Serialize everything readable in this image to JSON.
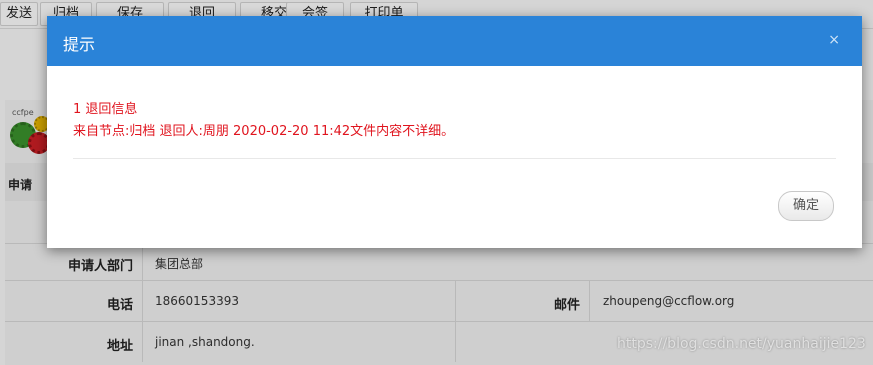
{
  "toolbar": {
    "buttons": [
      "发送",
      "归档",
      "保存",
      "退回",
      "移交",
      "会签",
      "打印单"
    ]
  },
  "logo": {
    "text": "ccfpe"
  },
  "form": {
    "section_label": "申请",
    "rows": {
      "department": {
        "label": "申请人部门",
        "value": "集团总部"
      },
      "phone": {
        "label": "电话",
        "value": "18660153393"
      },
      "email": {
        "label": "邮件",
        "value": "zhoupeng@ccflow.org"
      },
      "address": {
        "label": "地址",
        "value": "jinan ,shandong."
      }
    }
  },
  "dialog": {
    "title": "提示",
    "close": "×",
    "message_line1": "1   退回信息",
    "message_line2": "来自节点:归档 退回人:周朋 2020-02-20 11:42文件内容不详细。",
    "ok_label": "确定"
  },
  "watermark": "https://blog.csdn.net/yuanhaijie123",
  "colors": {
    "header_blue": "#2a83d8",
    "message_red": "#e0141e"
  }
}
